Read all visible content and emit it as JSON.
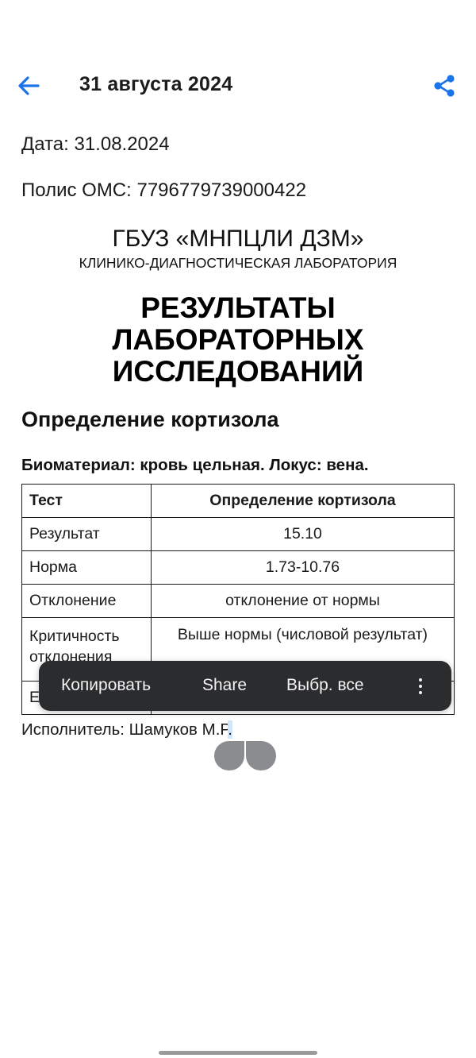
{
  "appbar": {
    "title": "31 августа 2024",
    "back_icon": "arrow-left-icon",
    "share_icon": "share-icon",
    "accent_color": "#1a73e8"
  },
  "document": {
    "date_line": "Дата: 31.08.2024",
    "policy_line": "Полис ОМС: 7796779739000422",
    "org_name": "ГБУЗ «МНПЦЛИ ДЗМ»",
    "org_subtitle": "КЛИНИКО-ДИАГНОСТИЧЕСКАЯ ЛАБОРАТОРИЯ",
    "title_lines": [
      "РЕЗУЛЬТАТЫ",
      "ЛАБОРАТОРНЫХ",
      "ИССЛЕДОВАНИЙ"
    ],
    "section_title": "Определение кортизола",
    "biomaterial": "Биоматериал: кровь цельная. Локус: вена.",
    "table": {
      "header": [
        "Тест",
        "Определение кортизола"
      ],
      "rows": [
        [
          "Результат",
          "15.10"
        ],
        [
          "Норма",
          "1.73-10.76"
        ],
        [
          "Отклонение",
          "отклонение от нормы"
        ],
        [
          "Критичность отклонения",
          "Выше нормы (числовой результат)"
        ],
        [
          "Е",
          ""
        ]
      ]
    },
    "executor_prefix": "Исполнитель: Шамуков М.Р",
    "executor_selected": "."
  },
  "context_menu": {
    "copy": "Копировать",
    "share": "Share",
    "select_all": "Выбр. все",
    "more_icon": "more-vertical-icon"
  }
}
